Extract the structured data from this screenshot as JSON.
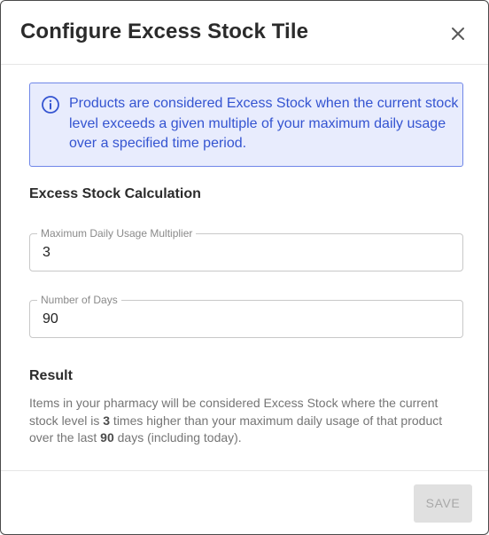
{
  "dialog": {
    "title": "Configure Excess Stock Tile",
    "close_icon": "close-icon"
  },
  "info": {
    "icon": "info-icon",
    "text": "Products are considered Excess Stock when the current stock level exceeds a given multiple of your maximum daily usage over a specified time period."
  },
  "calculation": {
    "heading": "Excess Stock Calculation",
    "multiplier": {
      "label": "Maximum Daily Usage Multiplier",
      "value": "3"
    },
    "days": {
      "label": "Number of Days",
      "value": "90"
    }
  },
  "result": {
    "heading": "Result",
    "part1": "Items in your pharmacy will be considered Excess Stock where the current stock level is ",
    "multiplier": "3",
    "part2": " times higher than your maximum daily usage of that product over the last ",
    "days": "90",
    "part3": " days (including today)."
  },
  "footer": {
    "save_label": "SAVE"
  },
  "colors": {
    "accent": "#3454d1",
    "info_bg": "#e8ecfd",
    "info_border": "#6f86e8",
    "disabled_bg": "#e0e0e0"
  }
}
